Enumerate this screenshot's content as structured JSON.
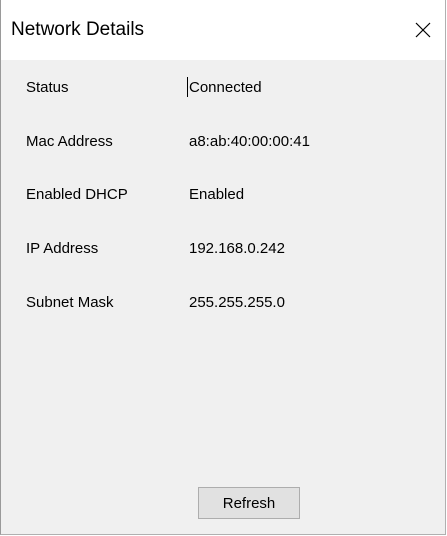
{
  "window": {
    "title": "Network Details",
    "close_icon": "close-icon"
  },
  "details": [
    {
      "label": "Status",
      "value": "Connected"
    },
    {
      "label": "Mac Address",
      "value": "a8:ab:40:00:00:41"
    },
    {
      "label": "Enabled DHCP",
      "value": "Enabled"
    },
    {
      "label": "IP Address",
      "value": "192.168.0.242"
    },
    {
      "label": "Subnet Mask",
      "value": "255.255.255.0"
    }
  ],
  "actions": {
    "refresh_label": "Refresh"
  },
  "colors": {
    "dialog_background": "#f0f0f0",
    "titlebar_background": "#ffffff",
    "button_background": "#e1e1e1",
    "button_border": "#adadad"
  }
}
